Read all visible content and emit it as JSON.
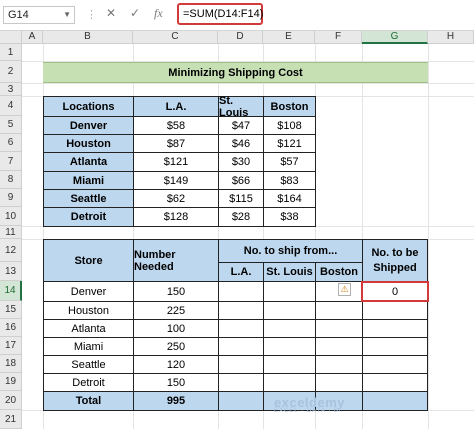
{
  "formula_bar": {
    "name_box": "G14",
    "formula": "=SUM(D14:F14)"
  },
  "columns": [
    "A",
    "B",
    "C",
    "D",
    "E",
    "F",
    "G",
    "H"
  ],
  "rows": [
    "1",
    "2",
    "3",
    "4",
    "5",
    "6",
    "7",
    "8",
    "9",
    "10",
    "11",
    "12",
    "13",
    "14",
    "15",
    "16",
    "17",
    "18",
    "19",
    "20",
    "21"
  ],
  "sheet_title": "Minimizing Shipping Cost",
  "cost_table": {
    "headers": [
      "Locations",
      "L.A.",
      "St. Louis",
      "Boston"
    ],
    "rows": [
      {
        "location": "Denver",
        "la": "$58",
        "stl": "$47",
        "bos": "$108"
      },
      {
        "location": "Houston",
        "la": "$87",
        "stl": "$46",
        "bos": "$121"
      },
      {
        "location": "Atlanta",
        "la": "$121",
        "stl": "$30",
        "bos": "$57"
      },
      {
        "location": "Miami",
        "la": "$149",
        "stl": "$66",
        "bos": "$83"
      },
      {
        "location": "Seattle",
        "la": "$62",
        "stl": "$115",
        "bos": "$164"
      },
      {
        "location": "Detroit",
        "la": "$128",
        "stl": "$28",
        "bos": "$38"
      }
    ]
  },
  "ship_table": {
    "store_header": "Store",
    "needed_header": "Number Needed",
    "ship_from_header": "No. to ship from...",
    "sub_headers": [
      "L.A.",
      "St. Louis",
      "Boston"
    ],
    "shipped_header": "No. to be Shipped",
    "rows": [
      {
        "store": "Denver",
        "needed": "150",
        "shipped": "0"
      },
      {
        "store": "Houston",
        "needed": "225",
        "shipped": ""
      },
      {
        "store": "Atlanta",
        "needed": "100",
        "shipped": ""
      },
      {
        "store": "Miami",
        "needed": "250",
        "shipped": ""
      },
      {
        "store": "Seattle",
        "needed": "120",
        "shipped": ""
      },
      {
        "store": "Detroit",
        "needed": "150",
        "shipped": ""
      }
    ],
    "total_label": "Total",
    "total_value": "995"
  },
  "watermark": {
    "name": "exceldemy",
    "tagline": "EXCEL · DATA · BI"
  }
}
